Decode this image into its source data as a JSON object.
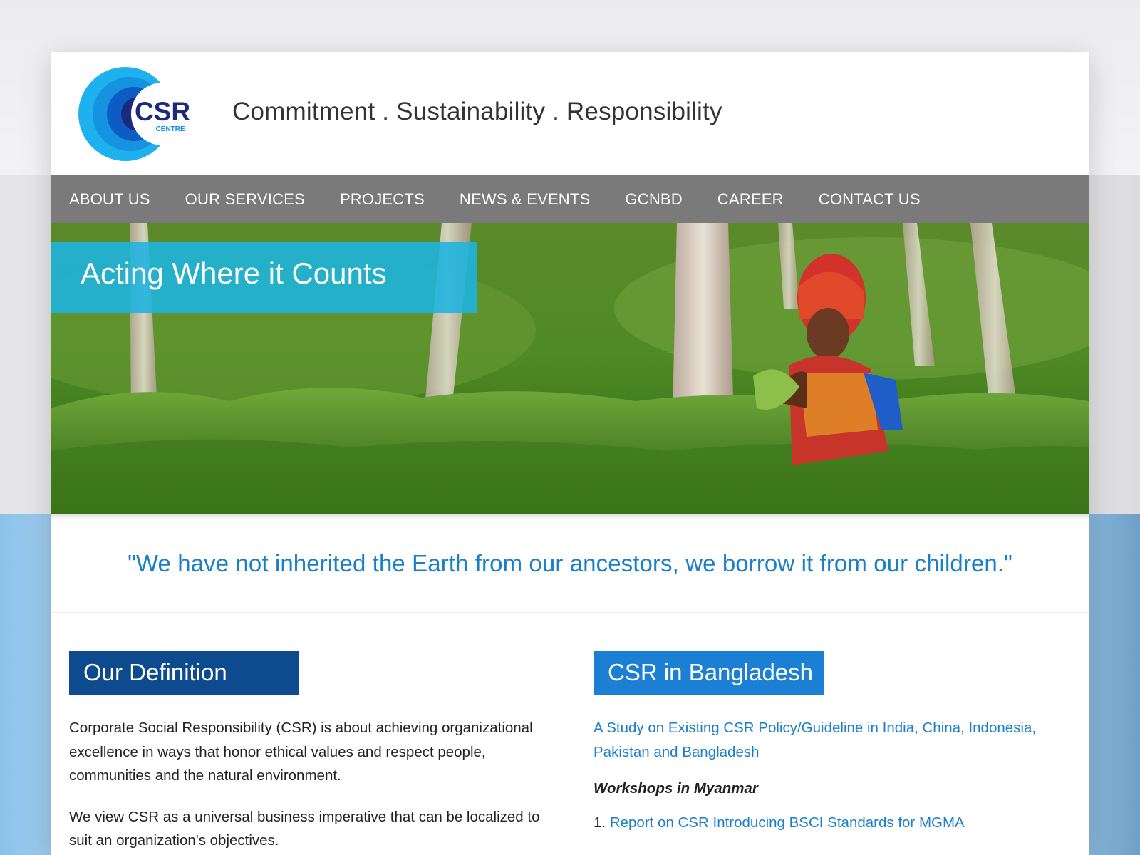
{
  "header": {
    "logo_text": "CSR",
    "logo_subtext": "CENTRE",
    "tagline": "Commitment . Sustainability . Responsibility"
  },
  "nav": {
    "items": [
      {
        "label": "ABOUT US"
      },
      {
        "label": "OUR SERVICES"
      },
      {
        "label": "PROJECTS"
      },
      {
        "label": "NEWS & EVENTS"
      },
      {
        "label": "GCNBD"
      },
      {
        "label": "CAREER"
      },
      {
        "label": "CONTACT US"
      }
    ]
  },
  "hero": {
    "title": "Acting Where it Counts"
  },
  "quote": "\"We have not inherited the Earth from our ancestors, we borrow it from our children.\"",
  "definition": {
    "heading": "Our Definition",
    "paragraphs": [
      "Corporate Social Responsibility (CSR) is about achieving organizational excellence in ways that honor ethical values and respect people, communities and the natural environment.",
      "We view CSR as a universal business imperative that can be localized to suit an organization's objectives."
    ]
  },
  "bangladesh": {
    "heading": "CSR in Bangladesh",
    "study_link": "A Study on Existing CSR Policy/Guideline in India, China, Indonesia, Pakistan and Bangladesh",
    "workshops_heading": "Workshops in Myanmar",
    "reports": [
      {
        "number": "1.",
        "label": "Report on CSR Introducing BSCI Standards for MGMA"
      }
    ]
  },
  "colors": {
    "nav_bg": "#7a7a7a",
    "hero_banner": "#1cb4e0",
    "definition_head": "#0d4a8e",
    "bangladesh_head": "#1b7fd3",
    "link": "#1a7fcb"
  }
}
